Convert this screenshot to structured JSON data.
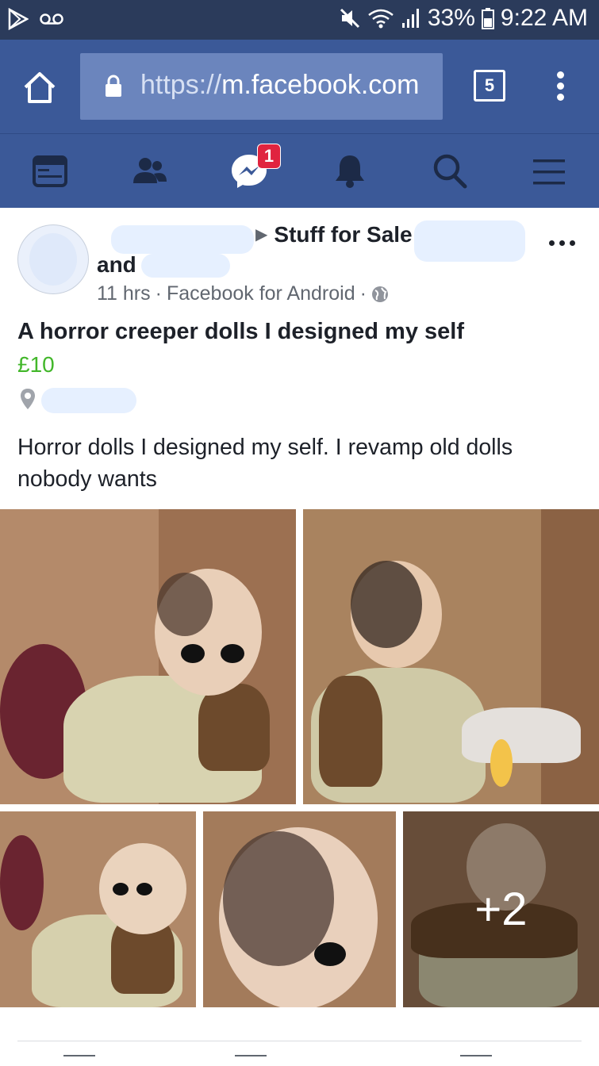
{
  "status_bar": {
    "battery_percent": "33%",
    "time": "9:22 AM",
    "icons": [
      "play-store-icon",
      "voicemail-icon",
      "mute-icon",
      "wifi-icon",
      "signal-icon",
      "battery-icon"
    ]
  },
  "browser": {
    "url_protocol": "https://",
    "url_host": "m.facebook.com",
    "tab_count": "5"
  },
  "fb_nav": {
    "items": [
      "news-feed-icon",
      "friends-icon",
      "messenger-icon",
      "notifications-icon",
      "search-icon",
      "menu-icon"
    ],
    "messenger_badge": "1",
    "colors": {
      "bar": "#3b5998",
      "badge": "#e0243f"
    }
  },
  "post": {
    "group_name": "Stuff for Sale",
    "author_line2_prefix": "and",
    "time_ago": "11 hrs",
    "separator": "·",
    "source": "Facebook for Android",
    "title": "A horror creeper dolls I designed my self",
    "price": "£10",
    "description": "Horror dolls I designed my self. I revamp old dolls nobody wants",
    "more_photos": "+2",
    "price_color": "#42b72a"
  }
}
